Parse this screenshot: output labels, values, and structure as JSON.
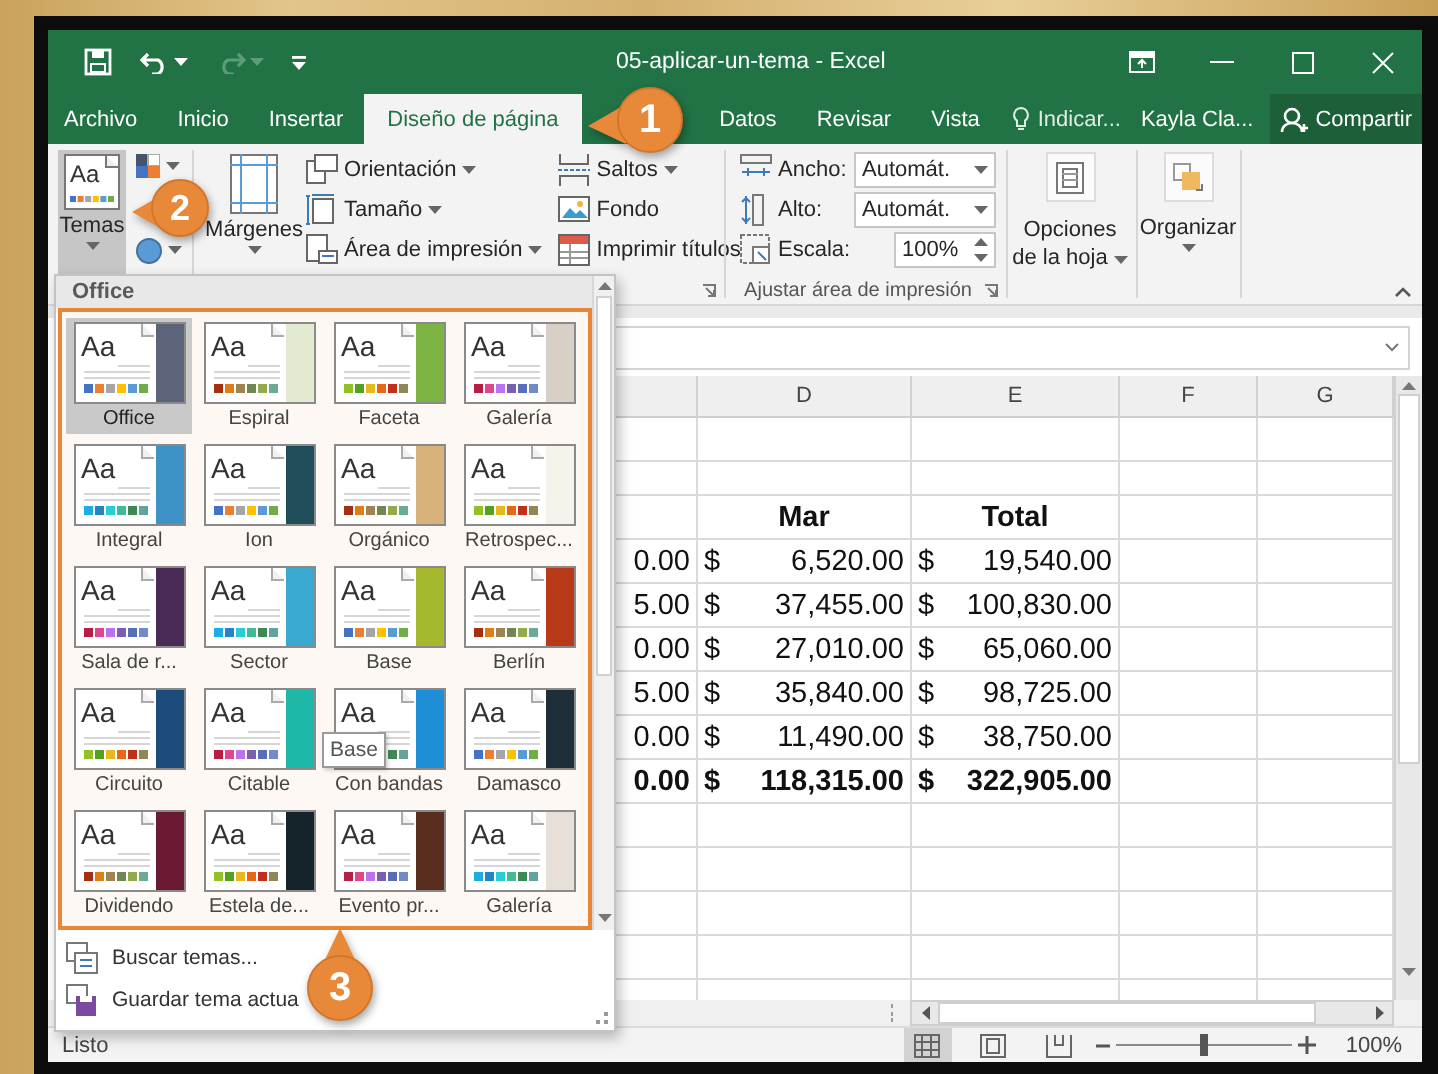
{
  "window": {
    "title": "05-aplicar-un-tema - Excel"
  },
  "tabs": [
    {
      "label": "Archivo",
      "selected": false
    },
    {
      "label": "Inicio",
      "selected": false
    },
    {
      "label": "Insertar",
      "selected": false
    },
    {
      "label": "Diseño de página",
      "selected": true
    },
    {
      "label": "Datos",
      "selected": false
    },
    {
      "label": "Revisar",
      "selected": false
    },
    {
      "label": "Vista",
      "selected": false
    }
  ],
  "tell_me": "Indicar...",
  "user": "Kayla Cla...",
  "share_button": "Compartir",
  "ribbon": {
    "themes_button": {
      "label": "Temas",
      "icon_text": "Aa",
      "pressed": true
    },
    "margins_button": "Márgenes",
    "page_setup": [
      {
        "label": "Orientación",
        "dropdown": true
      },
      {
        "label": "Tamaño",
        "dropdown": true
      },
      {
        "label": "Área de impresión",
        "dropdown": true
      }
    ],
    "sheet_tools": [
      {
        "label": "Saltos",
        "dropdown": true
      },
      {
        "label": "Fondo",
        "dropdown": false
      },
      {
        "label": "Imprimir títulos",
        "dropdown": false
      }
    ],
    "scale_to_fit": {
      "label": "Ajustar área de impresión",
      "fields": [
        {
          "label": "Ancho:",
          "value": "Automát.",
          "kind": "dropdown"
        },
        {
          "label": "Alto:",
          "value": "Automát.",
          "kind": "dropdown"
        },
        {
          "label": "Escala:",
          "value": "100%",
          "kind": "spinner"
        }
      ]
    },
    "sheet_options_button": "Opciones de la hoja",
    "arrange_button": "Organizar"
  },
  "sheet": {
    "columns": [
      "D",
      "E",
      "F",
      "G"
    ],
    "rows": [
      {
        "kind": "header",
        "column_d": "Mar",
        "column_e": "Total"
      },
      {
        "kind": "data",
        "column_c": "0.00",
        "column_d": {
          "symbol": "$",
          "amount": "6,520.00"
        },
        "column_e": {
          "symbol": "$",
          "amount": "19,540.00"
        }
      },
      {
        "kind": "data",
        "column_c": "5.00",
        "column_d": {
          "symbol": "$",
          "amount": "37,455.00"
        },
        "column_e": {
          "symbol": "$",
          "amount": "100,830.00"
        }
      },
      {
        "kind": "data",
        "column_c": "0.00",
        "column_d": {
          "symbol": "$",
          "amount": "27,010.00"
        },
        "column_e": {
          "symbol": "$",
          "amount": "65,060.00"
        }
      },
      {
        "kind": "data",
        "column_c": "5.00",
        "column_d": {
          "symbol": "$",
          "amount": "35,840.00"
        },
        "column_e": {
          "symbol": "$",
          "amount": "98,725.00"
        }
      },
      {
        "kind": "data",
        "column_c": "0.00",
        "column_d": {
          "symbol": "$",
          "amount": "11,490.00"
        },
        "column_e": {
          "symbol": "$",
          "amount": "38,750.00"
        }
      },
      {
        "kind": "total",
        "column_c": "0.00",
        "column_d": {
          "symbol": "$",
          "amount": "118,315.00"
        },
        "column_e": {
          "symbol": "$",
          "amount": "322,905.00"
        }
      }
    ]
  },
  "theme_gallery": {
    "section": "Office",
    "themes": [
      {
        "name": "Office",
        "sample": "Aa",
        "selected": true,
        "color": "#5b6478"
      },
      {
        "name": "Espiral",
        "sample": "Aa",
        "selected": false,
        "color": "#e3ead2"
      },
      {
        "name": "Faceta",
        "sample": "Aa",
        "selected": false,
        "color": "#7cb342"
      },
      {
        "name": "Galería",
        "sample": "Aa",
        "selected": false,
        "color": "#d8d0c6"
      },
      {
        "name": "Integral",
        "sample": "Aa",
        "selected": false,
        "color": "#3d93c6"
      },
      {
        "name": "Ion",
        "sample": "Aa",
        "selected": false,
        "color": "#1f4e5a"
      },
      {
        "name": "Orgánico",
        "sample": "Aa",
        "selected": false,
        "color": "#d8b27a"
      },
      {
        "name": "Retrospec...",
        "sample": "Aa",
        "selected": false,
        "color": "#f6f2ec"
      },
      {
        "name": "Sala de r...",
        "sample": "Aa",
        "selected": false,
        "color": "#4a2b58"
      },
      {
        "name": "Sector",
        "sample": "Aa",
        "selected": false,
        "color": "#3aa9d0"
      },
      {
        "name": "Base",
        "sample": "Aa",
        "selected": false,
        "color": "#a5b82e"
      },
      {
        "name": "Berlín",
        "sample": "Aa",
        "selected": false,
        "color": "#b83a1a"
      },
      {
        "name": "Circuito",
        "sample": "Aa",
        "selected": false,
        "color": "#1c4d7a"
      },
      {
        "name": "Citable",
        "sample": "Aa",
        "selected": false,
        "color": "#1fb8a8"
      },
      {
        "name": "Con bandas",
        "sample": "Aa",
        "selected": false,
        "color": "#1e8ed6"
      },
      {
        "name": "Damasco",
        "sample": "Aa",
        "selected": false,
        "color": "#1f2f3a"
      },
      {
        "name": "Dividendo",
        "sample": "Aa",
        "selected": false,
        "color": "#6a1b33"
      },
      {
        "name": "Estela de...",
        "sample": "Aa",
        "selected": false,
        "color": "#15232a"
      },
      {
        "name": "Evento pr...",
        "sample": "Aa",
        "selected": false,
        "color": "#5a2e1e"
      },
      {
        "name": "Galería",
        "sample": "Aa",
        "selected": false,
        "color": "#e6e0d8"
      }
    ],
    "tooltip": "Base",
    "actions": [
      "Buscar temas...",
      "Guardar tema actua"
    ]
  },
  "status_bar": {
    "text": "Listo",
    "views": [
      {
        "kind": "normal",
        "selected": true
      },
      {
        "kind": "page_layout",
        "selected": false
      },
      {
        "kind": "page_break",
        "selected": false
      }
    ],
    "zoom": {
      "level": 0.5,
      "reading": "100%"
    }
  },
  "callouts": [
    {
      "number": "1"
    },
    {
      "number": "2"
    },
    {
      "number": "3"
    }
  ]
}
